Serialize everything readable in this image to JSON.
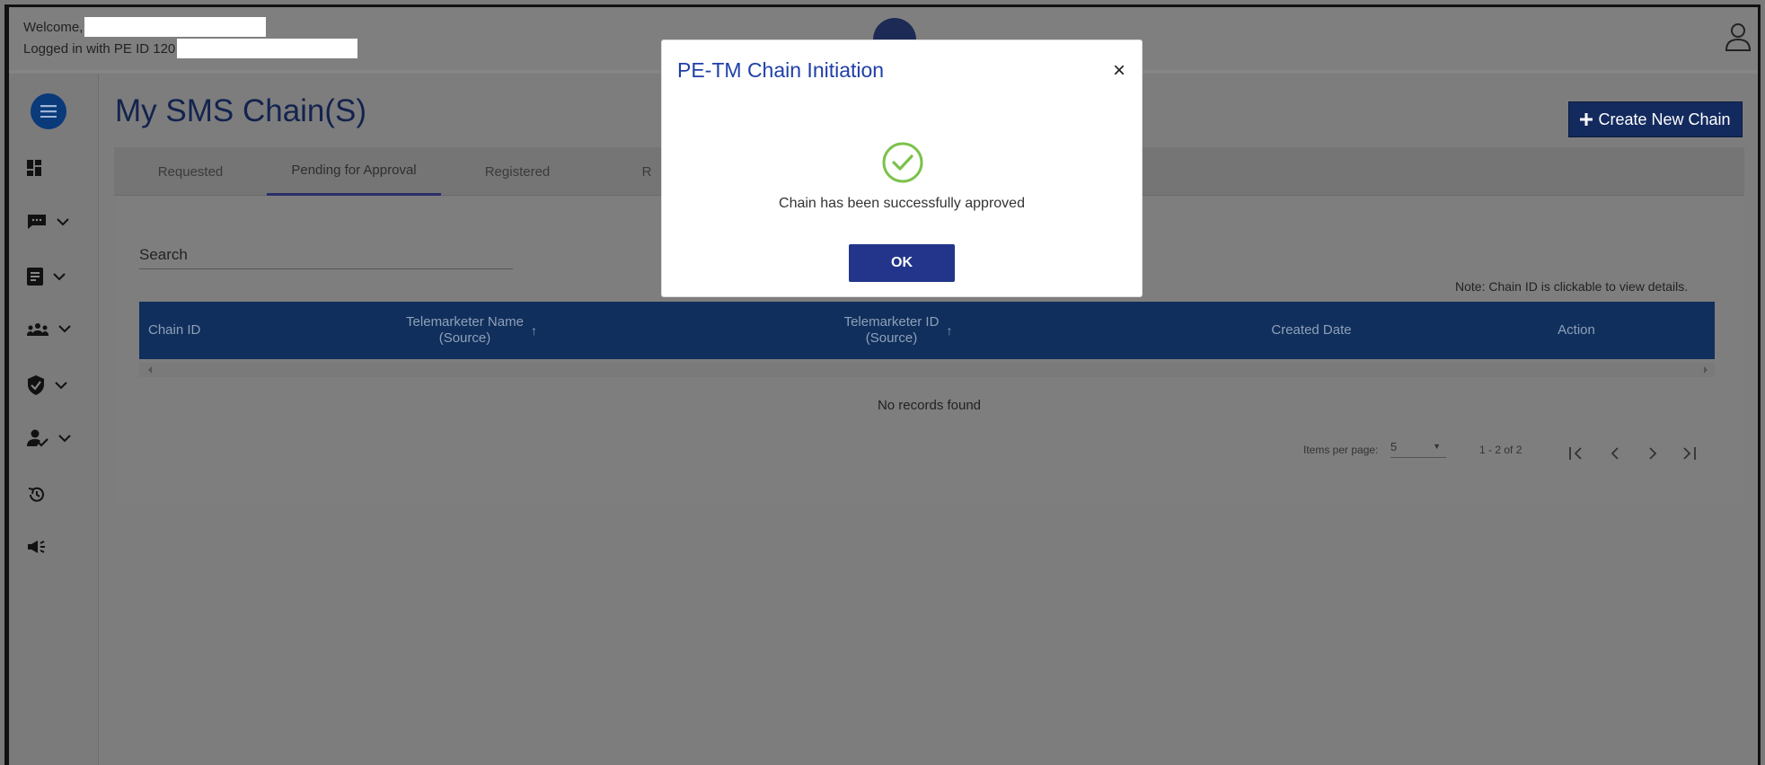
{
  "header": {
    "welcome_label": "Welcome,",
    "logged_in_label": "Logged in with PE ID 120"
  },
  "page": {
    "title": "My SMS Chain(S)",
    "create_button": "Create New Chain",
    "create_icon": "plus-icon"
  },
  "tabs": [
    "Requested",
    "Pending for Approval",
    "Registered",
    "R"
  ],
  "active_tab": "Pending for Approval",
  "search": {
    "label": "Search"
  },
  "note": "Note: Chain ID is clickable to view details.",
  "table": {
    "columns": [
      {
        "label": "Chain ID"
      },
      {
        "label": "Telemarketer Name\n(Source)",
        "line1": "Telemarketer Name",
        "line2": "(Source)"
      },
      {
        "label": "Telemarketer ID\n(Source)",
        "line1": "Telemarketer ID",
        "line2": "(Source)"
      },
      {
        "label": "Created Date"
      },
      {
        "label": "Action"
      }
    ],
    "empty_message": "No records found"
  },
  "pagination": {
    "items_per_page_label": "Items per page:",
    "items_per_page_value": "5",
    "range": "1 - 2 of 2"
  },
  "modal": {
    "title": "PE-TM Chain Initiation",
    "close": "×",
    "message": "Chain has been successfully approved",
    "ok": "OK"
  },
  "colors": {
    "brand": "#132a5e",
    "modal_title": "#1f3fa8",
    "success": "#7cc24a",
    "table_header": "#102f5c"
  }
}
